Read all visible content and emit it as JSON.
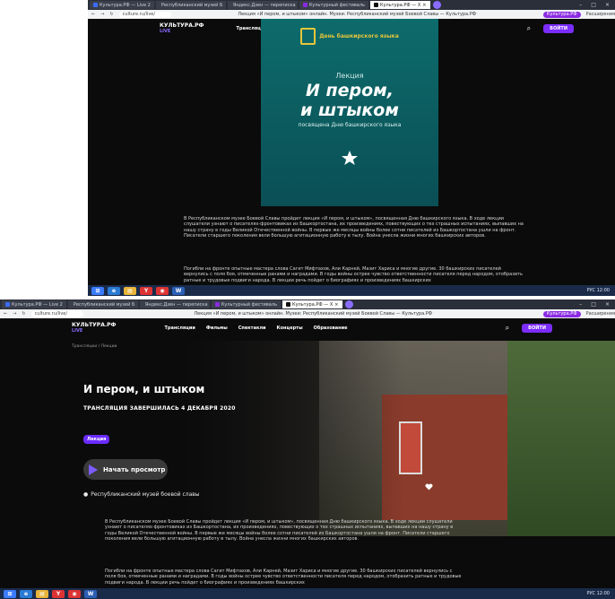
{
  "browser": {
    "tabs": [
      {
        "label": "Культура.РФ — Live 2",
        "color": "#3b6cff"
      },
      {
        "label": "Республиканский музей Б",
        "color": "#3b6cff"
      },
      {
        "label": "Яндекс.Дзен — переписка",
        "color": "#d02020"
      },
      {
        "label": "Культурный фестиваль",
        "color": "#8a2be2"
      },
      {
        "label": "Культура.РФ — Х",
        "color": "#111111",
        "active": true
      }
    ],
    "tab_close": "×",
    "newtab_icon": "plus-icon",
    "window_controls": [
      "–",
      "□",
      "×"
    ],
    "nav_buttons": [
      "←",
      "→",
      "↻"
    ],
    "url": "culture.ru/live/",
    "page_title": "Лекция «И пером, и штыком» онлайн. Музеи: Республиканский музей Боевой Славы — Культура.РФ",
    "bookmark_pill": "Культура.РФ",
    "extensions_label": "Расширения"
  },
  "header": {
    "logo": "КУЛЬТУРА.РФ",
    "logo_sub": "LIVE",
    "nav": [
      "Трансляции",
      "Фильмы",
      "Спектакли",
      "Концерты",
      "Образование"
    ],
    "login_button": "ВОЙТИ",
    "search_icon": "search-icon"
  },
  "screen1": {
    "poster": {
      "emblem_text": "День башкирского языка",
      "lecture": "Лекция",
      "title_line1": "И пером,",
      "title_line2": "и штыком",
      "dedication": "посвящена Дню башкирского языка"
    },
    "paragraph1": "В Республиканском музее Боевой Славы пройдет лекция «И пером, и штыком», посвященная Дню башкирского языка. В ходе лекции слушатели узнают о писателях-фронтовиках из Башкортостана, их произведениях, повествующих о тех страшных испытаниях, выпавших на нашу страну в годы Великой Отечественной войны. В первые же месяцы войны более сотни писателей из Башкортостана ушли на фронт. Писатели старшего поколения вели большую агитационную работу в тылу. Война унесла жизни многих башкирских авторов.",
    "paragraph2": "Погибли на фронте опытные мастера слова Сагит Мифтахов, Али Карней, Мазит Хариса и многие другие. 30 башкирских писателей вернулись с поля боя, отмеченные ранами и наградами. В годы войны острее чувство ответственности писателя перед народом, отобразить ратные и трудовые подвиги народа. В лекции речь пойдет о биографиях и произведениях башкирских"
  },
  "screen2": {
    "breadcrumb": "Трансляции / Лекции",
    "event_title": "И пером, и штыком",
    "broadcast_status": "ТРАНСЛЯЦИЯ ЗАВЕРШИЛАСЬ 4 ДЕКАБРЯ 2020",
    "badge": "Лекция",
    "play_button": "Начать просмотр",
    "venue": "Республиканский музей боевой славы",
    "paragraph1": "В Республиканском музее Боевой Славы пройдет лекция «И пером, и штыком», посвященная Дню башкирского языка. В ходе лекции слушатели узнают о писателях-фронтовиках из Башкортостана, их произведениях, повествующих о тех страшных испытаниях, выпавших на нашу страну в годы Великой Отечественной войны. В первые же месяцы войны более сотни писателей из Башкортостана ушли на фронт. Писатели старшего поколения вели большую агитационную работу в тылу. Война унесла жизни многих башкирских авторов.",
    "paragraph2": "Погибли на фронте опытные мастера слова Сагит Мифтахов, Али Карней, Мазит Хариса и многие другие. 30 башкирских писателей вернулись с поля боя, отмеченные ранами и наградами. В годы войны острее чувство ответственности писателя перед народом, отобразить ратные и трудовые подвиги народа. В лекции речь пойдет о биографиях и произведениях башкирских"
  },
  "taskbar": {
    "apps": [
      {
        "label": "⊞",
        "color": "#3b7cff"
      },
      {
        "label": "e",
        "color": "#2a7bd4"
      },
      {
        "label": "▤",
        "color": "#e8b53a"
      },
      {
        "label": "Y",
        "color": "#d33"
      },
      {
        "label": "◉",
        "color": "#d33"
      },
      {
        "label": "W",
        "color": "#2b5fb5"
      }
    ],
    "clock": "РУС 12:00"
  },
  "colors": {
    "accent": "#7b2cff",
    "poster_bg": "#0d6b6b",
    "page_bg": "#0b0b0b"
  }
}
